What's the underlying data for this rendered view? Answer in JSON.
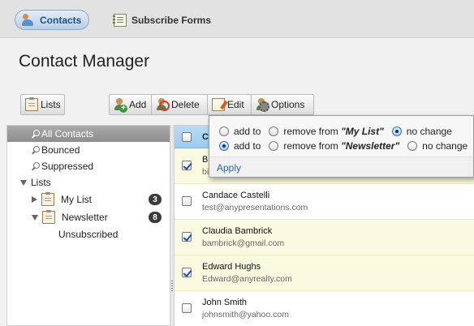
{
  "nav": {
    "tabs": [
      {
        "label": "Contacts",
        "icon": "contacts-icon",
        "active": true
      },
      {
        "label": "Subscribe Forms",
        "icon": "form-icon",
        "active": false
      }
    ]
  },
  "page_title": "Contact Manager",
  "toolbar": {
    "lists_label": "Lists",
    "add_label": "Add",
    "delete_label": "Delete",
    "edit_label": "Edit",
    "options_label": "Options"
  },
  "sidebar": {
    "all_contacts": "All Contacts",
    "bounced": "Bounced",
    "suppressed": "Suppressed",
    "lists_header": "Lists",
    "my_list": {
      "label": "My List",
      "count": "3"
    },
    "newsletter": {
      "label": "Newsletter",
      "count": "8"
    },
    "unsubscribed": "Unsubscribed"
  },
  "contacts": {
    "header": "C",
    "first_row": {
      "name": "B",
      "email": "bi"
    },
    "rows": [
      {
        "name": "Candace Castelli",
        "email": "test@anypresentations.com",
        "checked": false
      },
      {
        "name": "Claudia Bambrick",
        "email": "bambrick@gmail.com",
        "checked": true
      },
      {
        "name": "Edward Hughs",
        "email": "Edward@anyrealty.com",
        "checked": true
      },
      {
        "name": "John Smith",
        "email": "johnsmith@yahoo.com",
        "checked": false
      }
    ]
  },
  "popup": {
    "row1": {
      "add": "add to",
      "remove_prefix": "remove from",
      "list": "\"My List\"",
      "nochange": "no change"
    },
    "row2": {
      "add": "add to",
      "remove_prefix": "remove from",
      "list": "\"Newsletter\"",
      "nochange": "no change"
    },
    "apply": "Apply"
  },
  "colors": {
    "accent": "#2a66b0",
    "header_blue": "#a9d3f2",
    "selected_row": "#fafae0"
  }
}
